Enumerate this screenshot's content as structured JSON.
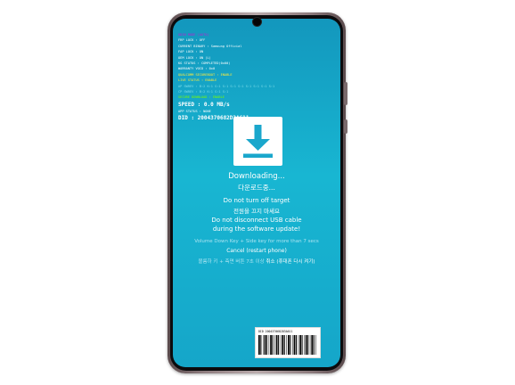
{
  "status_lines": [
    {
      "text": "ODIN MODE (AUTO)",
      "color": "#c01fd0"
    },
    {
      "text": "FRP LOCK : OFF",
      "color": "#ffffff"
    },
    {
      "text": "CURRENT BINARY : Samsung Official",
      "color": "#ffffff"
    },
    {
      "text": "FAP LOCK : ON",
      "color": "#ffffff"
    },
    {
      "text": "OEM LOCK : ON (L)",
      "color": "#ffffff"
    },
    {
      "text": "KG STATUS : COMPLETED(0x00)",
      "color": "#ffffff"
    },
    {
      "text": "WARRANTY VOID : 0x0",
      "color": "#ffffff"
    },
    {
      "text": "QUALCOMM SECUREBOOT : ENABLE",
      "color": "#ffeb3b"
    },
    {
      "text": "LIVE STATUS : ENABLE",
      "color": "#ffeb3b"
    },
    {
      "text": "AP SWREV : B:2 K:1 S:1 S:1 S:1 S:1 S:1 S:1 S:1 S:1",
      "color": "#80deea"
    },
    {
      "text": "CP SWREV : B:2 K:1 S:1 S:1",
      "color": "#80deea"
    },
    {
      "text": "SECURE DOWNLOAD : ENABLE",
      "color": "#7cfc00"
    },
    {
      "text": "DID : 2004370682D3A611",
      "color": "#ffffff"
    }
  ],
  "speed_line": "SPEED : 0.0 MB/s",
  "app_status": "APP STATUS : NONE",
  "did_line": "DID : 2004370682D3A611",
  "downloading": "Downloading...",
  "downloading_kr": "다운로드중...",
  "do_not_turn_off": "Do not turn off target",
  "do_not_turn_off_kr": "전원을 끄지 마세요",
  "do_not_disconnect_1": "Do not disconnect USB cable",
  "do_not_disconnect_2": "during the software update!",
  "volume_hint": "Volume Down Key + Side key for more than 7 secs",
  "cancel": "Cancel (restart phone)",
  "volume_hint_kr": "볼륨하 키 + 측면 버튼 7초 이상",
  "cancel_kr": "취소 (휴대폰 다시 켜기)",
  "barcode_label": "DID 2004370682D3A611",
  "colors": {
    "screen_top": "#1397bd",
    "screen_mid": "#18b6d2",
    "frame": "#8d7b7d"
  },
  "icons": [
    "download-arrow-icon",
    "barcode-icon",
    "front-camera-icon"
  ]
}
